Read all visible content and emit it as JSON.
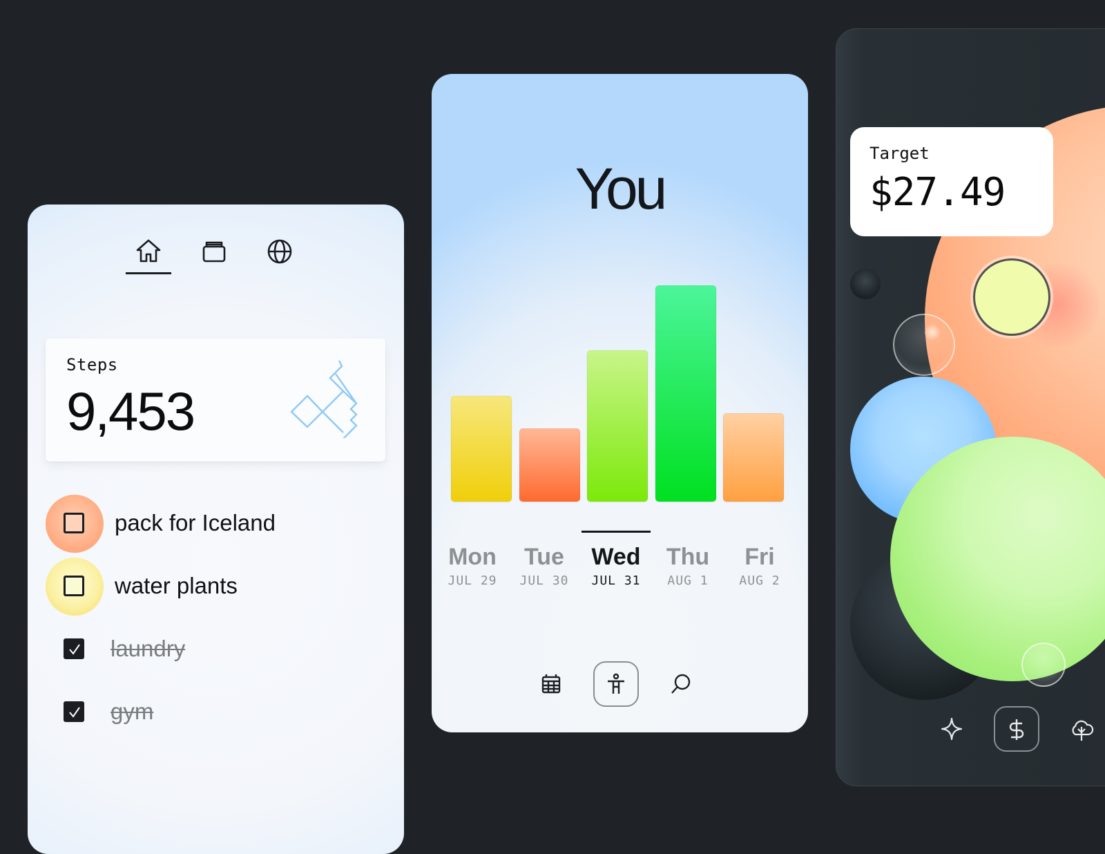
{
  "left_card": {
    "nav": [
      {
        "icon": "home-icon",
        "active": true
      },
      {
        "icon": "archive-icon",
        "active": false
      },
      {
        "icon": "globe-icon",
        "active": false
      }
    ],
    "steps": {
      "label": "Steps",
      "value": "9,453",
      "icon": "route-icon"
    },
    "todos": [
      {
        "text": "pack for Iceland",
        "checked": false,
        "accent": "#ffa878"
      },
      {
        "text": "water plants",
        "checked": false,
        "accent": "#fbe27a"
      },
      {
        "text": "laundry",
        "checked": true
      },
      {
        "text": "gym",
        "checked": true
      }
    ]
  },
  "middle_card": {
    "title": "You",
    "selected_day": "Wed",
    "nav": [
      {
        "icon": "calendar-icon",
        "active": false
      },
      {
        "icon": "accessibility-icon",
        "active": true
      },
      {
        "icon": "search-icon",
        "active": false
      }
    ]
  },
  "chart_data": {
    "type": "bar",
    "title": "You",
    "categories": [
      "Mon",
      "Tue",
      "Wed",
      "Thu",
      "Fri"
    ],
    "dates": [
      "JUL 29",
      "JUL 30",
      "JUL 31",
      "AUG 1",
      "AUG 2"
    ],
    "values": [
      0.49,
      0.34,
      0.7,
      1.0,
      0.41
    ],
    "value_units": "relative to max (no axis shown)",
    "colors": [
      [
        "#f7e77c",
        "#f0cf0a"
      ],
      [
        "#ffb896",
        "#ff6a30"
      ],
      [
        "#c8f58a",
        "#7ce90a"
      ],
      [
        "#4cf59a",
        "#00e020"
      ],
      [
        "#ffd0a4",
        "#ffa040"
      ]
    ],
    "selected": "Wed",
    "xlabel": "",
    "ylabel": "",
    "grid": false,
    "legend": "none"
  },
  "right_card": {
    "target": {
      "label": "Target",
      "value": "$27.49"
    },
    "nav": [
      {
        "icon": "sparkle-icon",
        "active": false
      },
      {
        "icon": "dollar-icon",
        "active": true
      },
      {
        "icon": "cloud-tree-icon",
        "active": false
      }
    ]
  }
}
